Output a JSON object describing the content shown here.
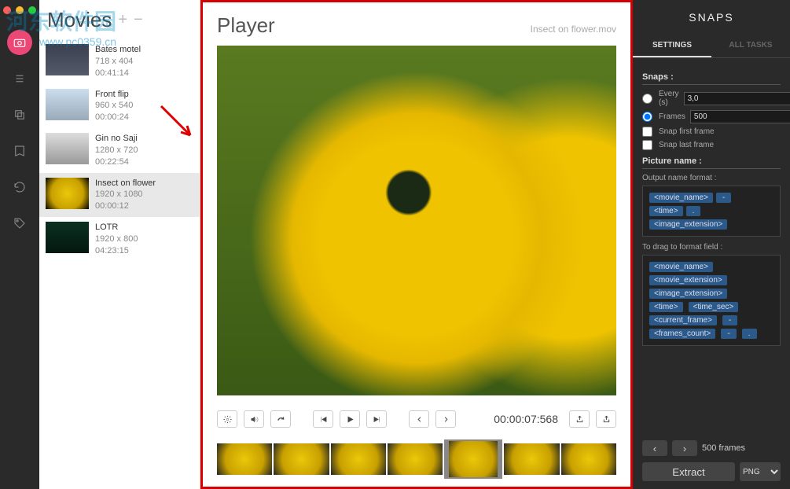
{
  "watermark": {
    "text": "河东软件园",
    "url": "www.pc0359.cn"
  },
  "movies": {
    "title": "Movies",
    "items": [
      {
        "name": "Bates motel",
        "dim": "718 x 404",
        "time": "00:41:14"
      },
      {
        "name": "Front flip",
        "dim": "960 x 540",
        "time": "00:00:24"
      },
      {
        "name": "Gin no Saji",
        "dim": "1280 x 720",
        "time": "00:22:54"
      },
      {
        "name": "Insect on flower",
        "dim": "1920 x 1080",
        "time": "00:00:12"
      },
      {
        "name": "LOTR",
        "dim": "1920 x 800",
        "time": "04:23:15"
      }
    ]
  },
  "player": {
    "title": "Player",
    "filename": "Insect on flower.mov",
    "timecode": "00:00:07:568"
  },
  "snaps": {
    "title": "SNAPS",
    "tabs": {
      "settings": "SETTINGS",
      "alltasks": "ALL TASKS"
    },
    "snaps_heading": "Snaps :",
    "every_label": "Every (s)",
    "every_value": "3,0",
    "frames_label": "Frames",
    "frames_value": "500",
    "snap_first": "Snap first frame",
    "snap_last": "Snap last frame",
    "picture_heading": "Picture name :",
    "output_label": "Output name format :",
    "output_tokens": [
      "<movie_name>",
      "-",
      "<time>",
      ".",
      "<image_extension>"
    ],
    "drag_label": "To drag to format field :",
    "drag_tokens": [
      "<movie_name>",
      "<movie_extension>",
      "<image_extension>",
      "<time>",
      "<time_sec>",
      "<current_frame>",
      "-",
      "<frames_count>",
      "-",
      "."
    ],
    "frame_count": "500 frames",
    "extract": "Extract",
    "format": "PNG"
  }
}
